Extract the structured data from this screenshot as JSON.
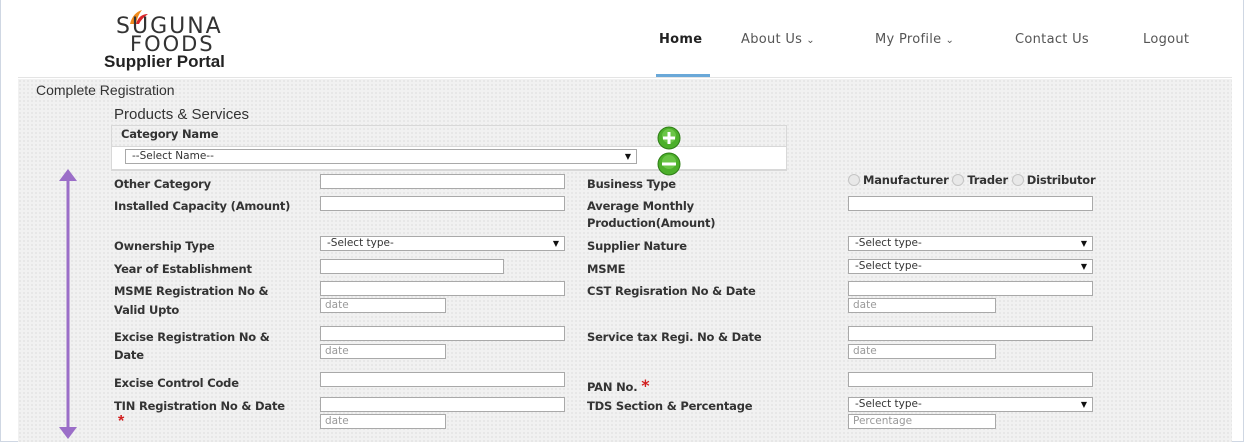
{
  "header": {
    "logo_line1": "SUGUNA",
    "logo_line2": "FOODS",
    "logo_line3": "Supplier Portal",
    "nav": [
      {
        "label": "Home"
      },
      {
        "label": "About Us"
      },
      {
        "label": "My Profile"
      },
      {
        "label": "Contact Us"
      },
      {
        "label": "Logout"
      }
    ],
    "chevron": "⌄"
  },
  "page": {
    "title": "Complete Registration",
    "section_title": "Products & Services",
    "category_header": "Category Name",
    "category_select": "--Select Name--"
  },
  "form": {
    "other_category": "Other Category",
    "business_type": "Business Type",
    "business_options": [
      "Manufacturer",
      "Trader",
      "Distributor"
    ],
    "installed_capacity": "Installed Capacity (Amount)",
    "avg_monthly_1": "Average Monthly",
    "avg_monthly_2": "Production(Amount)",
    "ownership_type": "Ownership Type",
    "ownership_select": "-Select type-",
    "supplier_nature": "Supplier Nature",
    "supplier_nature_select": "-Select type-",
    "year_establishment": "Year of Establishment",
    "msme": "MSME",
    "msme_select": "-Select type-",
    "msme_reg_1": "MSME Registration No &",
    "msme_reg_2": "Valid Upto",
    "cst_reg": "CST Regisration No & Date",
    "excise_reg_1": "Excise Registration No &",
    "excise_reg_2": "Date",
    "service_tax": "Service tax Regi. No & Date",
    "excise_control": "Excise Control Code",
    "pan_no": "PAN No.",
    "tin_reg": "TIN Registration No & Date",
    "tds_section": "TDS Section & Percentage",
    "tds_select": "-Select type-",
    "date_placeholder": "date",
    "percentage_placeholder": "Percentage",
    "required_mark": "*"
  },
  "colors": {
    "accent_underline": "#6aa8d8",
    "required": "#d21f1f",
    "add_button": "#4caf2a",
    "remove_button": "#4caf2a",
    "scroll_arrow": "#9b6ec8"
  },
  "icons": {
    "add": "plus-circle-icon",
    "remove": "minus-circle-icon",
    "scroll": "vertical-double-arrow-icon"
  }
}
